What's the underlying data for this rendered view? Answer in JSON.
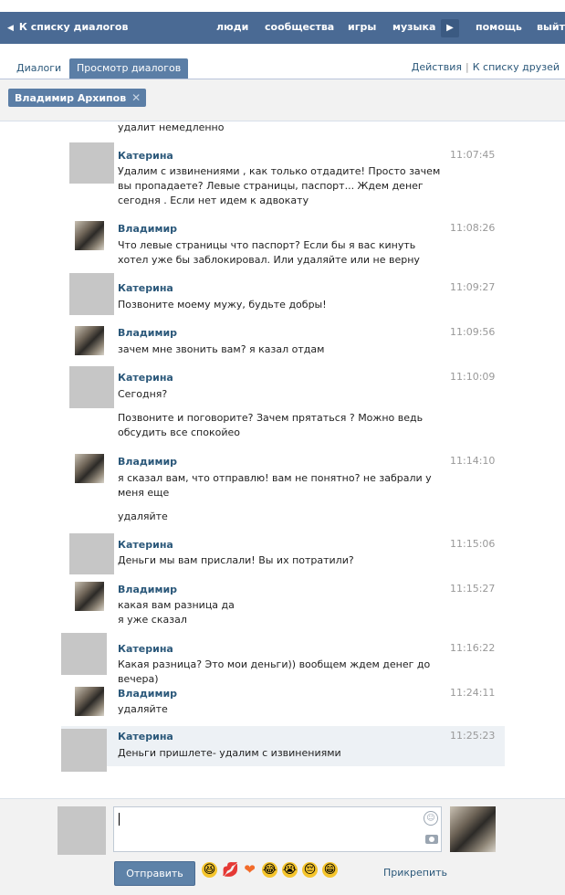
{
  "header": {
    "back_label": "К списку диалогов",
    "nav": [
      "люди",
      "сообщества",
      "игры",
      "музыка"
    ],
    "nav_more": "▶",
    "nav_right": [
      "помощь",
      "выйти"
    ]
  },
  "tabs": {
    "dialogs": "Диалоги",
    "view": "Просмотр диалогов",
    "actions": "Действия",
    "separator": "|",
    "to_friends": "К списку друзей"
  },
  "peer": {
    "name": "Владимир Архипов",
    "close": "✕"
  },
  "messages": [
    {
      "author": "",
      "time": "",
      "lines": [
        "удалит немедленно"
      ]
    },
    {
      "author": "Катерина",
      "time": "11:07:45",
      "lines": [
        "Удалим с извинениями , как только отдадите! Просто зачем вы пропадаете? Левые страницы, паспорт... Ждем денег сегодня . Если нет идем к адвокату"
      ]
    },
    {
      "author": "Владимир",
      "time": "11:08:26",
      "lines": [
        "Что левые страницы что паспорт? Если бы я вас кинуть хотел уже бы заблокировал. Или удаляйте или не верну"
      ]
    },
    {
      "author": "Катерина",
      "time": "11:09:27",
      "lines": [
        "Позвоните моему мужу, будьте добры!"
      ]
    },
    {
      "author": "Владимир",
      "time": "11:09:56",
      "lines": [
        "зачем мне звонить вам? я казал отдам"
      ]
    },
    {
      "author": "Катерина",
      "time": "11:10:09",
      "lines": [
        "Сегодня?",
        "Позвоните и поговорите? Зачем прятаться ? Можно ведь обсудить все спокойео"
      ]
    },
    {
      "author": "Владимир",
      "time": "11:14:10",
      "lines": [
        "я сказал вам, что отправлю! вам не понятно? не забрали у меня еще",
        "удаляйте"
      ]
    },
    {
      "author": "Катерина",
      "time": "11:15:06",
      "lines": [
        "Деньги мы вам прислали! Вы их потратили?"
      ]
    },
    {
      "author": "Владимир",
      "time": "11:15:27",
      "lines": [
        "какая вам разница да",
        "я уже сказал"
      ]
    },
    {
      "author": "Катерина",
      "time": "11:16:22",
      "lines": [
        "Какая разница? Это мои деньги)) вообщем ждем денег до вечера)"
      ]
    },
    {
      "author": "Владимир",
      "time": "11:24:11",
      "lines": [
        "удаляйте"
      ]
    },
    {
      "author": "Катерина",
      "time": "11:25:23",
      "lines": [
        "Деньги пришлете- удалим с извинениями"
      ]
    }
  ],
  "composer": {
    "value": "",
    "send_label": "Отправить",
    "attach_label": "Прикрепить",
    "emojis": [
      "😆",
      "💋",
      "❤",
      "😂",
      "😭",
      "😔",
      "😁"
    ]
  }
}
